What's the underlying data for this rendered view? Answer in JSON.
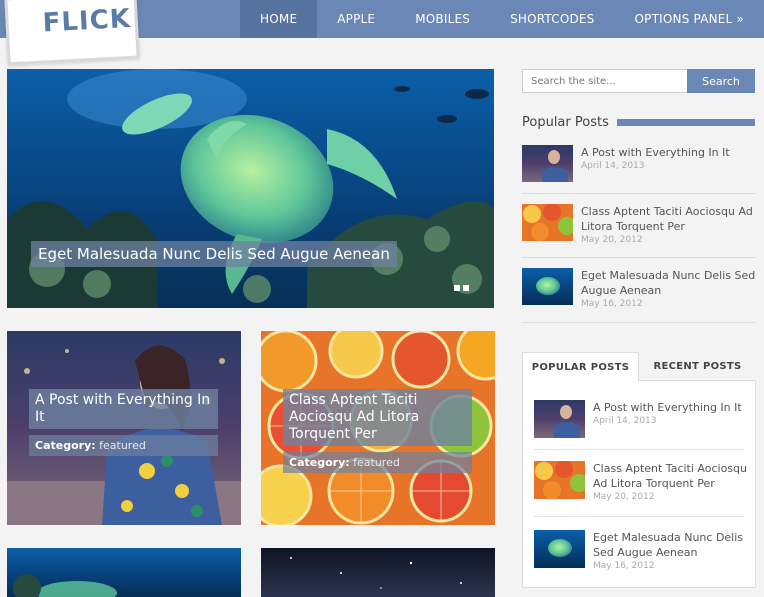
{
  "logo": {
    "text": "FLICK"
  },
  "nav": [
    {
      "label": "HOME",
      "active": true
    },
    {
      "label": "APPLE"
    },
    {
      "label": "MOBILES"
    },
    {
      "label": "SHORTCODES"
    },
    {
      "label": "OPTIONS PANEL »"
    }
  ],
  "slider": {
    "caption": "Eget Malesuada Nunc Delis Sed Augue Aenean"
  },
  "cards": [
    {
      "title": "A Post with Everything In It",
      "category_label": "Category:",
      "category": "featured"
    },
    {
      "title": "Class Aptent Taciti Aociosqu Ad Litora Torquent Per",
      "category_label": "Category:",
      "category": "featured"
    }
  ],
  "search": {
    "placeholder": "Search the site...",
    "button": "Search"
  },
  "popular": {
    "heading": "Popular Posts",
    "items": [
      {
        "title": "A Post with Everything In It",
        "date": "April 14, 2013"
      },
      {
        "title": "Class Aptent Taciti Aociosqu Ad Litora Torquent Per",
        "date": "May 20, 2012"
      },
      {
        "title": "Eget Malesuada Nunc Delis Sed Augue Aenean",
        "date": "May 16, 2012"
      }
    ]
  },
  "tabs": {
    "popular_label": "POPULAR POSTS",
    "recent_label": "RECENT POSTS",
    "items": [
      {
        "title": "A Post with Everything In It",
        "date": "April 14, 2013"
      },
      {
        "title": "Class Aptent Taciti Aociosqu Ad Litora Torquent Per",
        "date": "May 20, 2012"
      },
      {
        "title": "Eget Malesuada Nunc Delis Sed Augue Aenean",
        "date": "May 16, 2012"
      }
    ]
  },
  "colors": {
    "accent": "#6b87b6",
    "accent_dark": "#56739f"
  }
}
